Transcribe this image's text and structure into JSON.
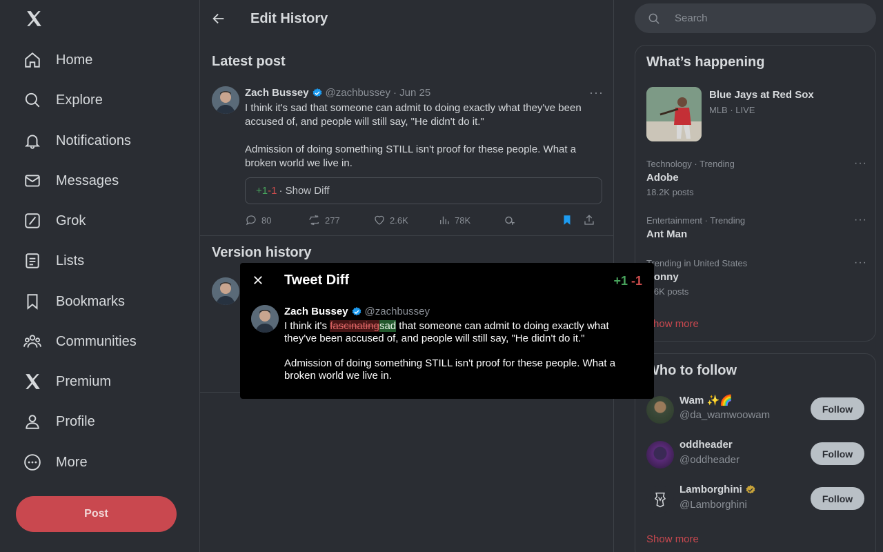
{
  "nav": {
    "items": [
      {
        "label": "Home"
      },
      {
        "label": "Explore"
      },
      {
        "label": "Notifications"
      },
      {
        "label": "Messages"
      },
      {
        "label": "Grok"
      },
      {
        "label": "Lists"
      },
      {
        "label": "Bookmarks"
      },
      {
        "label": "Communities"
      },
      {
        "label": "Premium"
      },
      {
        "label": "Profile"
      },
      {
        "label": "More"
      }
    ],
    "post_label": "Post"
  },
  "main": {
    "header_title": "Edit History",
    "latest_title": "Latest post",
    "version_title": "Version history",
    "tweet": {
      "name": "Zach Bussey",
      "handle": "@zachbussey",
      "date": "· Jun 25",
      "para1": "I think it's sad that someone can admit to doing exactly what they've been accused of, and people will still say, \"He didn't do it.\"",
      "para2": "Admission of doing something STILL isn't proof for these people. What a broken world we live in.",
      "diff_plus": "+1",
      "diff_minus": "-1",
      "diff_label": "· Show Diff",
      "replies": "80",
      "reposts": "277",
      "likes": "2.6K",
      "views": "78K"
    }
  },
  "modal": {
    "title": "Tweet Diff",
    "plus": "+1",
    "minus": "-1",
    "name": "Zach Bussey",
    "handle": "@zachbussey",
    "text_before": "I think it's ",
    "text_deleted": "fascinating",
    "text_inserted": "sad",
    "text_after": " that someone can admit to doing exactly what they've been accused of, and people will still say, \"He didn't do it.\"",
    "para2": "Admission of doing something STILL isn't proof for these people. What a broken world we live in."
  },
  "sidebar": {
    "search_placeholder": "Search",
    "happening_title": "What’s happening",
    "main_trend": {
      "title": "Blue Jays at Red Sox",
      "sub": "MLB · LIVE"
    },
    "trends": [
      {
        "meta": "Technology · Trending",
        "name": "Adobe",
        "count": "18.2K posts"
      },
      {
        "meta": "Entertainment · Trending",
        "name": "Ant Man",
        "count": ""
      },
      {
        "meta": "Trending in United States",
        "name": "Ronny",
        "count": "5.6K posts"
      }
    ],
    "show_more": "Show more",
    "wtf_title": "Who to follow",
    "follows": [
      {
        "name": "Wam ✨🌈",
        "handle": "@da_wamwoowam",
        "button": "Follow"
      },
      {
        "name": "oddheader",
        "handle": "@oddheader",
        "button": "Follow"
      },
      {
        "name": "Lamborghini",
        "handle": "@Lamborghini",
        "button": "Follow"
      }
    ],
    "wtf_show_more": "Show more"
  },
  "colors": {
    "accent": "#c9484f",
    "verified_blue": "#1d9bf0",
    "verified_gold": "#c9a43a",
    "diff_plus": "#48a35c",
    "diff_minus": "#cc4c4c"
  }
}
